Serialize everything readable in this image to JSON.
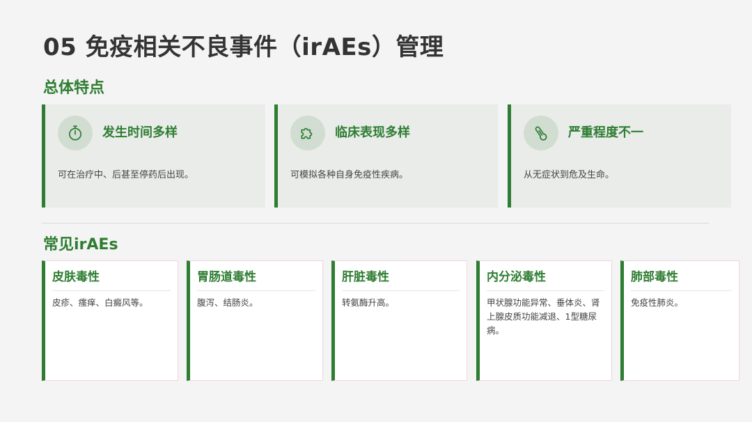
{
  "page": {
    "title": "05 免疫相关不良事件（irAEs）管理"
  },
  "overview": {
    "heading": "总体特点",
    "features": [
      {
        "icon": "stopwatch-icon",
        "title": "发生时间多样",
        "description": "可在治疗中、后甚至停药后出现。"
      },
      {
        "icon": "puzzle-icon",
        "title": "临床表现多样",
        "description": "可模拟各种自身免疫性疾病。"
      },
      {
        "icon": "thermometer-icon",
        "title": "严重程度不一",
        "description": "从无症状到危及生命。"
      }
    ]
  },
  "common": {
    "heading": "常见irAEs",
    "cards": [
      {
        "title": "皮肤毒性",
        "description": "皮疹、瘙痒、白癜风等。"
      },
      {
        "title": "胃肠道毒性",
        "description": "腹泻、结肠炎。"
      },
      {
        "title": "肝脏毒性",
        "description": "转氨酶升高。"
      },
      {
        "title": "内分泌毒性",
        "description": "甲状腺功能异常、垂体炎、肾上腺皮质功能减退、1型糖尿病。"
      },
      {
        "title": "肺部毒性",
        "description": "免疫性肺炎。"
      }
    ]
  },
  "colors": {
    "accent": "#2e7d32",
    "feature_bg": "#e9ece9",
    "icon_bg": "#d2ddd2",
    "card_border": "#ecd6dd"
  }
}
